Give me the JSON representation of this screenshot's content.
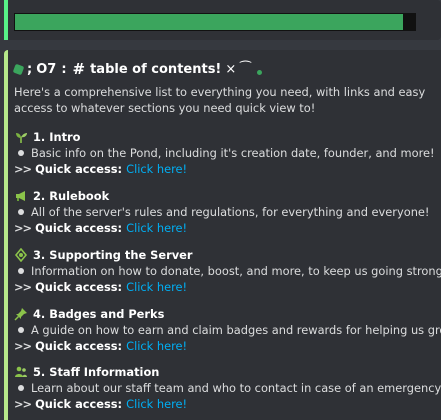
{
  "banner": {
    "progress": 0.97
  },
  "title": {
    "prefix": ";",
    "code": "O7",
    "separator": ":",
    "hash": "#",
    "text": "table of contents!",
    "close": "×",
    "trail": "⁀"
  },
  "intro": "Here's a comprehensive list to everything you need, with links and easy access to whatever sections you need quick view to!",
  "quick_access_arrows": ">>",
  "quick_access_label": "Quick access:",
  "sections": [
    {
      "number": "1.",
      "title": "Intro",
      "icon": "sprout-icon",
      "description": "Basic info on the Pond, including it's creation date, founder, and more!",
      "link": "Click here!"
    },
    {
      "number": "2.",
      "title": "Rulebook",
      "icon": "megaphone-icon",
      "description": "All of the server's rules and regulations, for everything and everyone!",
      "link": "Click here!"
    },
    {
      "number": "3.",
      "title": "Supporting the Server",
      "icon": "gem-icon",
      "description": "Information on how to donate, boost, and more, to keep us going strong!",
      "link": "Click here!"
    },
    {
      "number": "4.",
      "title": "Badges and Perks",
      "icon": "pin-icon",
      "description": "A guide on how to earn and claim badges and rewards for helping us grow!",
      "link": "Click here!"
    },
    {
      "number": "5.",
      "title": "Staff Information",
      "icon": "people-icon",
      "description": "Learn about our staff team and who to contact in case of an emergency!",
      "link": "Click here!"
    }
  ],
  "colors": {
    "accent": "#3ba55d",
    "link": "#00aff4",
    "embed_border": "#b6e88a"
  }
}
